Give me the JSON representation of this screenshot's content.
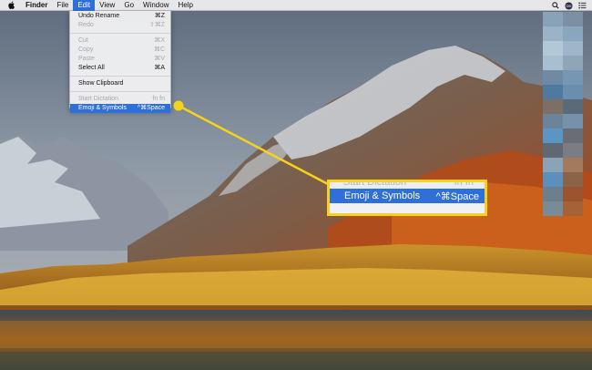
{
  "menubar": {
    "items": [
      "Finder",
      "File",
      "Edit",
      "View",
      "Go",
      "Window",
      "Help"
    ]
  },
  "edit_menu": {
    "items": [
      {
        "label": "Undo Rename",
        "shortcut": "⌘Z",
        "enabled": true
      },
      {
        "label": "Redo",
        "shortcut": "⇧⌘Z",
        "enabled": false
      },
      {
        "separator": true
      },
      {
        "label": "Cut",
        "shortcut": "⌘X",
        "enabled": false
      },
      {
        "label": "Copy",
        "shortcut": "⌘C",
        "enabled": false
      },
      {
        "label": "Paste",
        "shortcut": "⌘V",
        "enabled": false
      },
      {
        "label": "Select All",
        "shortcut": "⌘A",
        "enabled": true
      },
      {
        "separator": true
      },
      {
        "label": "Show Clipboard",
        "shortcut": "",
        "enabled": true
      },
      {
        "separator": true
      },
      {
        "label": "Start Dictation",
        "shortcut": "fn fn",
        "enabled": false
      },
      {
        "label": "Emoji & Symbols",
        "shortcut": "^⌘Space",
        "enabled": true,
        "highlighted": true
      }
    ]
  },
  "callout": {
    "ghost_label": "Start Dictation",
    "ghost_shortcut": "fn fn",
    "label": "Emoji & Symbols",
    "shortcut": "^⌘Space"
  },
  "colors": {
    "highlight": "#2f6fd8",
    "callout_accent": "#f6d31b"
  },
  "icons": [
    "apple-logo-icon",
    "search-icon",
    "siri-icon",
    "notification-center-icon"
  ]
}
